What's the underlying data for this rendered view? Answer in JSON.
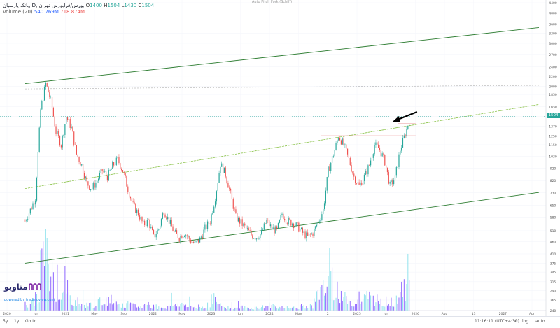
{
  "header": {
    "symbol_line": "بانک پارسیان, D, بورس/فرابورس تهران",
    "open_label": "O",
    "open": "1400",
    "high_label": "H",
    "high": "1504",
    "low_label": "L",
    "low": "1430",
    "close_label": "C",
    "close": "1504",
    "volume_title": "Volume (20)",
    "volume_value": "540.769M",
    "volume_ma": "718.874M",
    "center_note": "Auto Pitch Fork (Schiff)"
  },
  "logo": {
    "name": "متاویو",
    "sub": "powered by tradingview.com"
  },
  "price_badge": "1504",
  "bottom_bar": {
    "ranges": [
      "5y",
      "1y",
      "Go to..."
    ],
    "time": "11:16:11 (UTC+4:30)",
    "pct": "%",
    "log": "log",
    "auto": "auto"
  },
  "colors": {
    "up": "#26a69a",
    "down": "#ef5350",
    "channel": "#2e7d32",
    "median": "#8bc34a",
    "resistance": "#d32f2f",
    "volume_up": "#80deea",
    "volume_down": "#7c4dff",
    "arrow": "#000000"
  },
  "chart_data": {
    "type": "candlestick",
    "title": "بانک پارسیان, D, بورس/فرابورس تهران",
    "y_ticks": [
      "4400",
      "4000",
      "3600",
      "3300",
      "3000",
      "2700",
      "2400",
      "2200",
      "2000",
      "1850",
      "1650",
      "1504",
      "1370",
      "1250",
      "1150",
      "1030",
      "920",
      "820",
      "730",
      "650",
      "580",
      "510",
      "460",
      "410",
      "375",
      "345",
      "315",
      "290",
      "265",
      "240"
    ],
    "x_ticks": [
      "2020",
      "Jun",
      "2021",
      "May",
      "Sep",
      "2022",
      "May",
      "2023",
      "Jun",
      "2024",
      "May",
      "2",
      "2025",
      "Jun",
      "2026",
      "Aug",
      "13",
      "2027",
      "Apr"
    ],
    "last_price": 1504,
    "ohlc": {
      "open": 1400,
      "high": 1504,
      "low": 1430,
      "close": 1504
    },
    "price_path": [
      [
        0,
        560
      ],
      [
        2,
        620
      ],
      [
        4,
        700
      ],
      [
        6,
        1600
      ],
      [
        8,
        2050
      ],
      [
        10,
        1750
      ],
      [
        12,
        1300
      ],
      [
        14,
        1150
      ],
      [
        16,
        1500
      ],
      [
        18,
        1350
      ],
      [
        20,
        1050
      ],
      [
        22,
        950
      ],
      [
        24,
        800
      ],
      [
        26,
        760
      ],
      [
        28,
        820
      ],
      [
        30,
        900
      ],
      [
        32,
        850
      ],
      [
        34,
        940
      ],
      [
        36,
        1000
      ],
      [
        38,
        900
      ],
      [
        40,
        760
      ],
      [
        42,
        650
      ],
      [
        44,
        600
      ],
      [
        46,
        540
      ],
      [
        48,
        560
      ],
      [
        50,
        480
      ],
      [
        52,
        520
      ],
      [
        54,
        620
      ],
      [
        56,
        560
      ],
      [
        58,
        500
      ],
      [
        60,
        480
      ],
      [
        62,
        500
      ],
      [
        64,
        470
      ],
      [
        66,
        450
      ],
      [
        68,
        470
      ],
      [
        70,
        520
      ],
      [
        72,
        560
      ],
      [
        74,
        700
      ],
      [
        76,
        960
      ],
      [
        78,
        870
      ],
      [
        80,
        720
      ],
      [
        82,
        580
      ],
      [
        84,
        550
      ],
      [
        86,
        520
      ],
      [
        88,
        490
      ],
      [
        90,
        480
      ],
      [
        92,
        500
      ],
      [
        94,
        560
      ],
      [
        96,
        520
      ],
      [
        98,
        510
      ],
      [
        100,
        600
      ],
      [
        102,
        560
      ],
      [
        104,
        550
      ],
      [
        106,
        530
      ],
      [
        108,
        500
      ],
      [
        110,
        480
      ],
      [
        112,
        500
      ],
      [
        114,
        550
      ],
      [
        116,
        620
      ],
      [
        118,
        900
      ],
      [
        120,
        1050
      ],
      [
        122,
        1250
      ],
      [
        124,
        1150
      ],
      [
        126,
        1000
      ],
      [
        128,
        850
      ],
      [
        130,
        780
      ],
      [
        132,
        850
      ],
      [
        134,
        950
      ],
      [
        136,
        1150
      ],
      [
        138,
        1100
      ],
      [
        140,
        980
      ],
      [
        142,
        780
      ],
      [
        144,
        840
      ],
      [
        146,
        1100
      ],
      [
        148,
        1280
      ],
      [
        150,
        1504
      ]
    ],
    "volume_series": [
      0.1,
      0.15,
      0.2,
      0.9,
      0.95,
      0.6,
      0.35,
      0.3,
      0.25,
      0.2,
      0.15,
      0.12,
      0.1,
      0.1,
      0.12,
      0.15,
      0.2,
      0.18,
      0.15,
      0.1,
      0.08,
      0.1,
      0.08,
      0.06,
      0.1,
      0.08,
      0.07,
      0.06,
      0.05,
      0.08,
      0.1,
      0.12,
      0.1,
      0.07,
      0.06,
      0.05,
      0.06,
      0.05,
      0.2,
      0.12,
      0.08,
      0.06,
      0.05,
      0.05,
      0.06,
      0.05,
      0.04,
      0.05,
      0.06,
      0.08,
      0.1,
      0.07,
      0.05,
      0.05,
      0.06,
      0.05,
      0.05,
      0.06,
      0.08,
      0.25,
      0.3,
      0.35,
      0.6,
      0.4,
      0.3,
      0.2,
      0.15,
      0.12,
      0.15,
      0.2,
      0.25,
      0.2,
      0.18,
      0.15,
      0.12,
      0.15,
      0.2,
      0.4,
      0.7,
      0.95
    ],
    "pitchfork": {
      "upper_line": [
        [
          0,
          2050
        ],
        [
          150,
          3050
        ]
      ],
      "upper_median": [
        [
          0,
          1950
        ],
        [
          150,
          2000
        ]
      ],
      "median_line": [
        [
          0,
          760
        ],
        [
          150,
          1380
        ]
      ],
      "lower_line": [
        [
          0,
          375
        ],
        [
          150,
          620
        ]
      ]
    },
    "resistance_levels": [
      1250,
      1400
    ],
    "annotations": [
      "arrow pointing to breakout"
    ]
  }
}
